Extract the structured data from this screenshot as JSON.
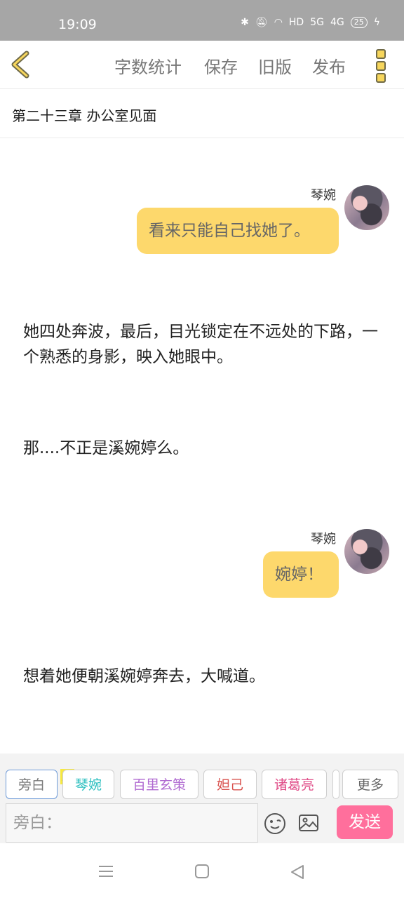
{
  "status": {
    "time": "19:09",
    "signal_5g": "5G",
    "signal_4g": "4G",
    "hd": "HD",
    "battery": "25"
  },
  "toolbar": {
    "word_count": "字数统计",
    "save": "保存",
    "old_version": "旧版",
    "publish": "发布"
  },
  "chapter": {
    "title": "第二十三章 办公室见面"
  },
  "messages": [
    {
      "name": "琴婉",
      "text": "看来只能自己找她了。"
    },
    {
      "text": "她四处奔波，最后，目光锁定在不远处的下路，一个熟悉的身影，映入她眼中。"
    },
    {
      "text": "那....不正是溪婉婷么。"
    },
    {
      "name": "琴婉",
      "text": "婉婷！"
    },
    {
      "text": "想着她便朝溪婉婷奔去，大喊道。"
    }
  ],
  "chips": {
    "narrator": "旁白",
    "main_badge": "主",
    "c1": "琴婉",
    "c2": "百里玄策",
    "c3": "妲己",
    "c4": "诸葛亮",
    "more": "更多"
  },
  "chip_colors": {
    "c1": "#2bbfbf",
    "c2": "#b06ad1",
    "c3": "#d9534f",
    "c4": "#e0508a"
  },
  "composer": {
    "placeholder": "旁白：",
    "send": "发送"
  },
  "icons": [
    "bluetooth-icon",
    "mute-bell-icon",
    "wifi-icon",
    "battery-icon",
    "back-chevron-icon",
    "more-menu-icon",
    "emoji-icon",
    "image-icon",
    "nav-menu-icon",
    "nav-home-icon",
    "nav-back-icon"
  ]
}
